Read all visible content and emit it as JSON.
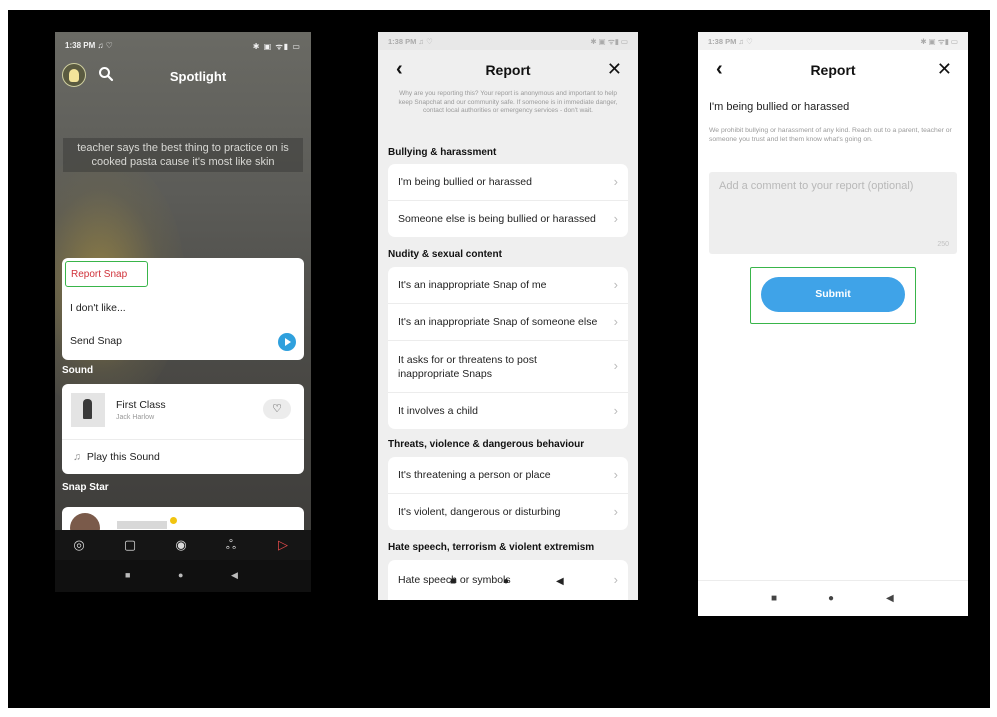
{
  "phone1": {
    "status": {
      "time": "1:38 PM ♫ ♡",
      "right": "✱ ▣ ᯤ▮ ▭"
    },
    "header": {
      "title": "Spotlight"
    },
    "caption": "teacher says the best thing to practice on is cooked pasta cause it's most like skin",
    "menu": {
      "report": "Report Snap",
      "dislike": "I don't like...",
      "send": "Send Snap"
    },
    "sound": {
      "section": "Sound",
      "track": "First Class",
      "artist": "Jack Harlow",
      "play": "Play this Sound",
      "music_glyph": "♫",
      "heart_glyph": "♡"
    },
    "snap_star": {
      "section": "Snap Star"
    },
    "tabs": [
      "◎",
      "▢",
      "◉",
      "ஃ",
      "▷"
    ],
    "nav": [
      "■",
      "●",
      "◀"
    ]
  },
  "phone2": {
    "status": {
      "time": "1:38 PM ♫ ♡",
      "right": "✱ ▣ ᯤ▮ ▭"
    },
    "header": {
      "back": "‹",
      "title": "Report",
      "close": "✕"
    },
    "intro": "Why are you reporting this? Your report is anonymous and important to help keep Snapchat and our community safe. If someone is in immediate danger, contact local authorities or emergency services - don't wait.",
    "chevron": "›",
    "sections": {
      "bullying": "Bullying & harassment",
      "nudity": "Nudity & sexual content",
      "threats": "Threats, violence & dangerous behaviour",
      "hate": "Hate speech, terrorism & violent extremism"
    },
    "options": {
      "b1": "I'm being bullied or harassed",
      "b2": "Someone else is being bullied or harassed",
      "n1": "It's an inappropriate Snap of me",
      "n2": "It's an inappropriate Snap of someone else",
      "n3": "It asks for or threatens to post inappropriate Snaps",
      "n4": "It involves a child",
      "t1": "It's threatening a person or place",
      "t2": "It's violent, dangerous or disturbing",
      "h1": "Hate speech or symbols"
    },
    "nav": [
      "■",
      "●",
      "◀"
    ]
  },
  "phone3": {
    "status": {
      "time": "1:38 PM ♫ ♡",
      "right": "✱ ▣ ᯤ▮ ▭"
    },
    "header": {
      "back": "‹",
      "title": "Report",
      "close": "✕"
    },
    "selected": "I'm being bullied or harassed",
    "description": "We prohibit bullying or harassment of any kind. Reach out to a parent, teacher or someone you trust and let them know what's going on.",
    "comment": {
      "placeholder": "Add a comment to your report (optional)",
      "counter": "250"
    },
    "submit": "Submit",
    "nav": [
      "■",
      "●",
      "◀"
    ]
  },
  "colors": {
    "highlight_border": "#39b54a",
    "report_red": "#d0323a",
    "submit_blue": "#3fa3e8",
    "send_blue": "#2fa0dd"
  }
}
